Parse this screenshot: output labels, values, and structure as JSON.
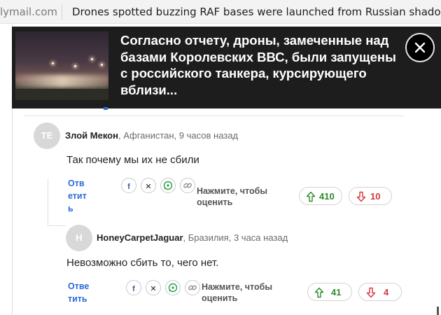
{
  "tab": {
    "domain": "lymail.com",
    "title": "Drones spotted buzzing RAF bases were launched from Russian shadow fl"
  },
  "video_overlay": {
    "headline": "Согласно отчету, дроны, замеченные над базами Королевских ВВС, были запущены с российского танкера, курсирующего вблизи..."
  },
  "comments": [
    {
      "avatar_initials": "TE",
      "author": "Злой Мекон",
      "location_time": ", Афганистан, 9 часов назад",
      "text": "Так почему мы их не сбили",
      "reply_line1": "Отв",
      "reply_line2": "етит",
      "reply_line3": "ь",
      "rate_line1": "Нажмите, чтобы",
      "rate_line2": "оценить",
      "upvotes": "410",
      "downvotes": "10"
    },
    {
      "avatar_initials": "H",
      "author": "HoneyCarpetJaguar",
      "location_time": ", Бразилия, 3 часа назад",
      "text": "Невозможно сбить то, чего нет.",
      "reply_line1": "Отве",
      "reply_line2": "тить",
      "rate_line1": "Нажмите, чтобы",
      "rate_line2": "оценить",
      "upvotes": "41",
      "downvotes": "4"
    }
  ],
  "share_icons": [
    "facebook-icon",
    "x-icon",
    "whatsapp-icon",
    "link-icon"
  ],
  "colors": {
    "link_blue": "#2a6bd9",
    "upvote_green": "#2e8b2e",
    "downvote_red": "#d6363c",
    "overlay_bg": "#1d1d1d"
  }
}
